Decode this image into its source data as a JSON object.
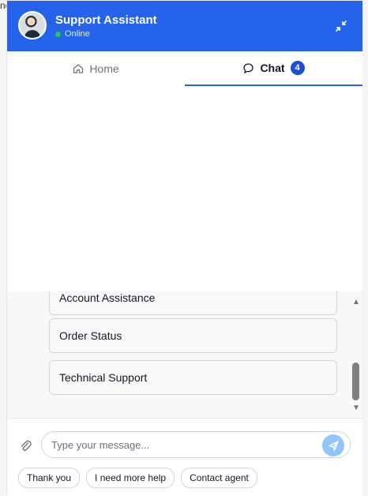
{
  "background_text": "ne",
  "header": {
    "title": "Support Assistant",
    "status": "Online"
  },
  "tabs": [
    {
      "label": "Home",
      "icon": "home-icon"
    },
    {
      "label": "Chat",
      "icon": "chat-icon",
      "badge": "4"
    }
  ],
  "options": [
    "Account Assistance",
    "Order Status",
    "Technical Support"
  ],
  "composer": {
    "placeholder": "Type your message...",
    "chips": [
      "Thank you",
      "I need more help",
      "Contact agent"
    ]
  },
  "colors": {
    "header": "#2563eb",
    "online": "#22c55e",
    "send_button": "#93c5fd"
  }
}
